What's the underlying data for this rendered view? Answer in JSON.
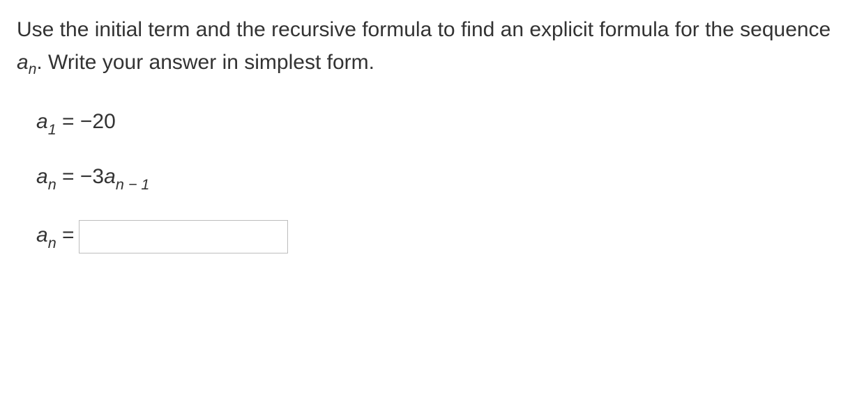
{
  "prompt": {
    "part1": "Use the initial term and the recursive formula to find an explicit formula for the sequence ",
    "seq_var_base": "a",
    "seq_var_sub": "n",
    "part2": ". Write your answer in simplest form."
  },
  "equations": {
    "initial": {
      "lhs_base": "a",
      "lhs_sub": "1",
      "eq": " = ",
      "rhs": "−20"
    },
    "recursive": {
      "lhs_base": "a",
      "lhs_sub": "n",
      "eq": " = ",
      "coef": "−3",
      "rhs_base": "a",
      "rhs_sub": "n − 1"
    },
    "answer": {
      "lhs_base": "a",
      "lhs_sub": "n",
      "eq": " = ",
      "value": ""
    }
  }
}
